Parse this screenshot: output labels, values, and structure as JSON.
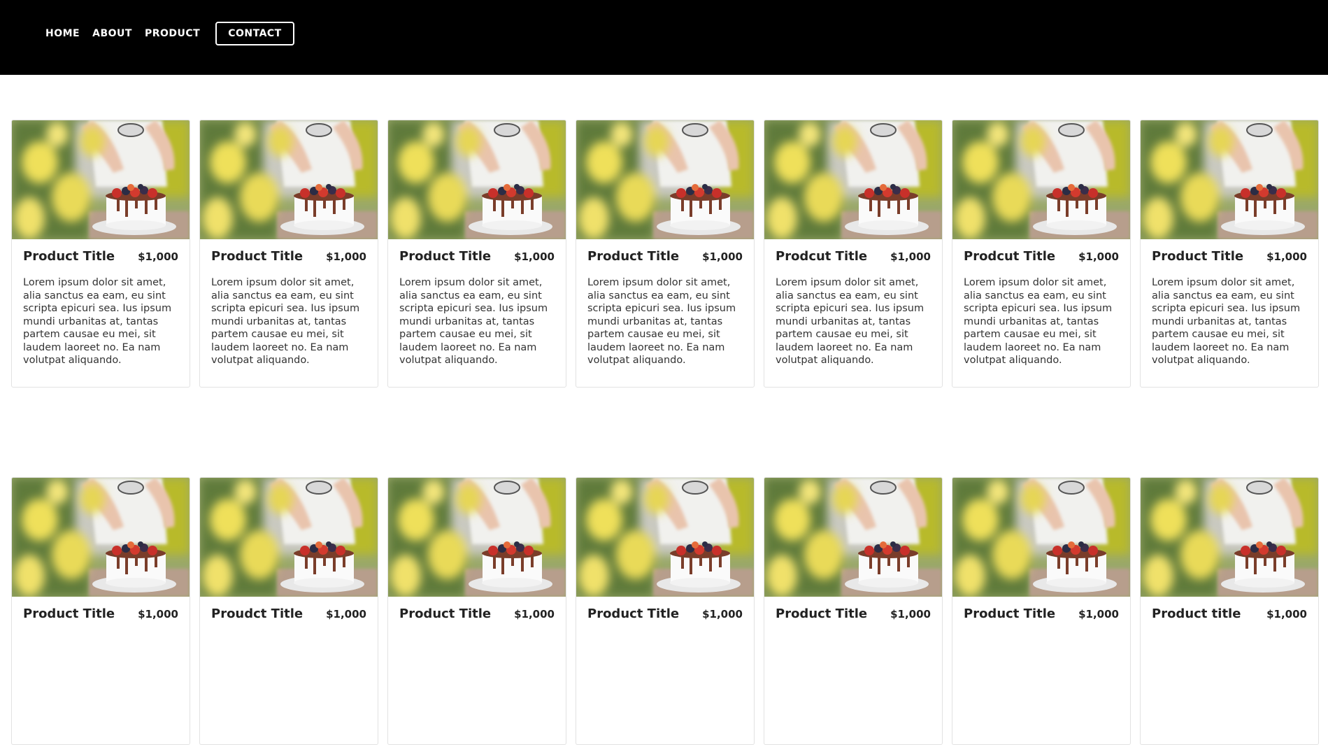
{
  "nav": {
    "home": "HOME",
    "about": "ABOUT",
    "product": "PRODUCT",
    "contact": "CONTACT"
  },
  "colors": {
    "header_bg": "#000000",
    "nav_text": "#ffffff"
  },
  "rows": [
    [
      {
        "title": "Product Title",
        "price": "$1,000",
        "desc": "Lorem ipsum dolor sit amet, alia sanctus ea eam, eu sint scripta epicuri sea. Ius ipsum mundi urbanitas at, tantas partem causae eu mei, sit laudem laoreet no. Ea nam volutpat aliquando."
      },
      {
        "title": "Product Title",
        "price": "$1,000",
        "desc": "Lorem ipsum dolor sit amet, alia sanctus ea eam, eu sint scripta epicuri sea. Ius ipsum mundi urbanitas at, tantas partem causae eu mei, sit laudem laoreet no. Ea nam volutpat aliquando."
      },
      {
        "title": "Product Title",
        "price": "$1,000",
        "desc": "Lorem ipsum dolor sit amet, alia sanctus ea eam, eu sint scripta epicuri sea. Ius ipsum mundi urbanitas at, tantas partem causae eu mei, sit laudem laoreet no. Ea nam volutpat aliquando."
      },
      {
        "title": "Product Title",
        "price": "$1,000",
        "desc": "Lorem ipsum dolor sit amet, alia sanctus ea eam, eu sint scripta epicuri sea. Ius ipsum mundi urbanitas at, tantas partem causae eu mei, sit laudem laoreet no. Ea nam volutpat aliquando."
      },
      {
        "title": "Prodcut Title",
        "price": "$1,000",
        "desc": "Lorem ipsum dolor sit amet, alia sanctus ea eam, eu sint scripta epicuri sea. Ius ipsum mundi urbanitas at, tantas partem causae eu mei, sit laudem laoreet no. Ea nam volutpat aliquando."
      },
      {
        "title": "Prodcut Title",
        "price": "$1,000",
        "desc": "Lorem ipsum dolor sit amet, alia sanctus ea eam, eu sint scripta epicuri sea. Ius ipsum mundi urbanitas at, tantas partem causae eu mei, sit laudem laoreet no. Ea nam volutpat aliquando."
      },
      {
        "title": "Product Title",
        "price": "$1,000",
        "desc": "Lorem ipsum dolor sit amet, alia sanctus ea eam, eu sint scripta epicuri sea. Ius ipsum mundi urbanitas at, tantas partem causae eu mei, sit laudem laoreet no. Ea nam volutpat aliquando."
      }
    ],
    [
      {
        "title": "Product Title",
        "price": "$1,000"
      },
      {
        "title": "Proudct Title",
        "price": "$1,000"
      },
      {
        "title": "Product Title",
        "price": "$1,000"
      },
      {
        "title": "Product Title",
        "price": "$1,000"
      },
      {
        "title": "Product Title",
        "price": "$1,000"
      },
      {
        "title": "Product Title",
        "price": "$1,000"
      },
      {
        "title": "Product title",
        "price": "$1,000"
      }
    ]
  ]
}
